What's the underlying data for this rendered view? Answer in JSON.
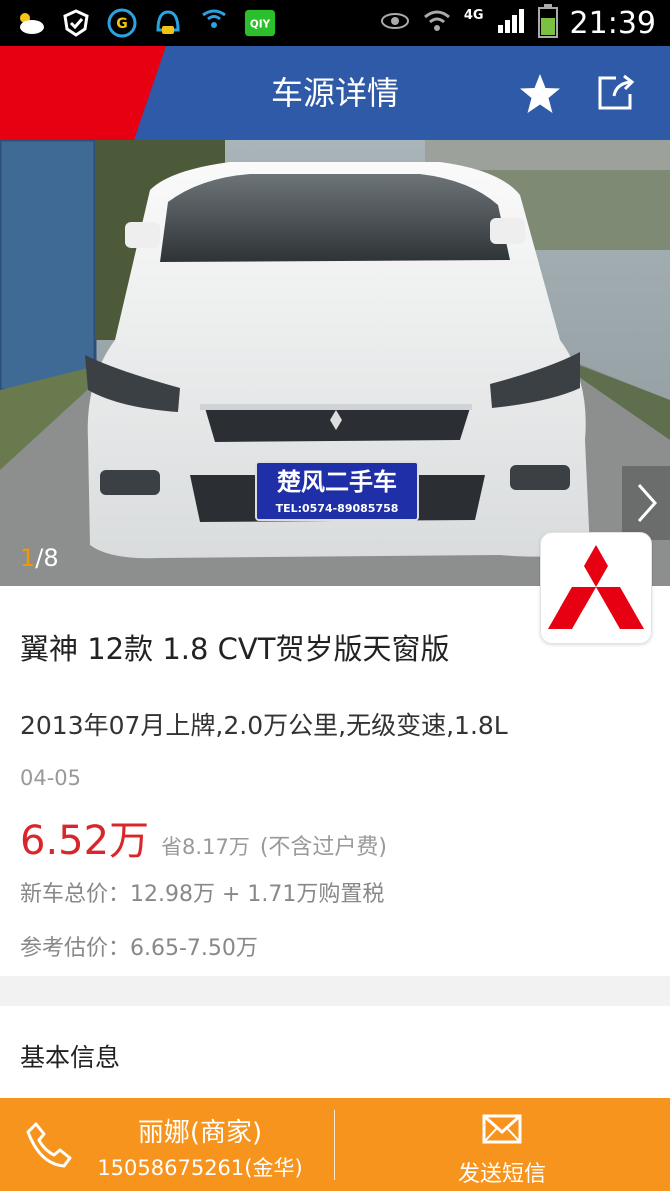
{
  "status_bar": {
    "network": "4G",
    "time": "21:39",
    "icons": [
      "weather-icon",
      "security-icon",
      "g-app-icon",
      "chat-app-icon",
      "wifi-broadcast-icon",
      "iqiyi-icon",
      "eye-icon",
      "wifi-icon",
      "signal-icon",
      "battery-icon"
    ]
  },
  "header": {
    "title": "车源详情",
    "accent_red": "#e60012",
    "bar_blue": "#2f5aa8"
  },
  "gallery": {
    "current": "1",
    "total": "/8",
    "plate_text": "楚风二手车",
    "plate_phone": "TEL:0574-89085758"
  },
  "car": {
    "title": "翼神 12款 1.8 CVT贺岁版天窗版",
    "specs": "2013年07月上牌,2.0万公里,无级变速,1.8L",
    "date": "04-05",
    "price": "6.52万",
    "save": "省8.17万",
    "save_note": "(不含过户费)",
    "new_car_price": "新车总价：12.98万 + 1.71万购置税",
    "estimate": "参考估价：6.65-7.50万"
  },
  "sections": {
    "basic_info": "基本信息"
  },
  "bottom_bar": {
    "dealer_name": "丽娜(商家)",
    "dealer_phone": "15058675261(金华)",
    "sms_label": "发送短信",
    "color": "#f7941d"
  }
}
